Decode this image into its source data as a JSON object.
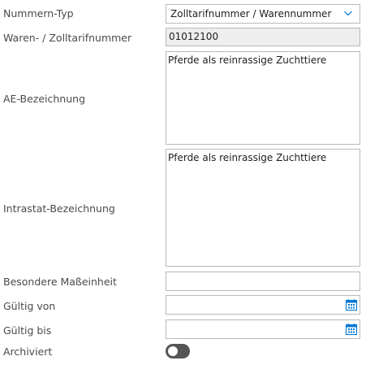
{
  "fields": {
    "nummern_typ": {
      "label": "Nummern-Typ",
      "value": "Zolltarifnummer / Warennummer"
    },
    "waren_zolltarifnummer": {
      "label": "Waren- / Zolltarifnummer",
      "value": "01012100"
    },
    "ae_bezeichnung": {
      "label": "AE-Bezeichnung",
      "value": "Pferde als reinrassige Zuchttiere"
    },
    "intrastat_bezeichnung": {
      "label": "Intrastat-Bezeichnung",
      "value": "Pferde als reinrassige Zuchttiere"
    },
    "besondere_masseinheit": {
      "label": "Besondere Maßeinheit",
      "value": ""
    },
    "gueltig_von": {
      "label": "Gültig von",
      "value": ""
    },
    "gueltig_bis": {
      "label": "Gültig bis",
      "value": ""
    },
    "archiviert": {
      "label": "Archiviert",
      "state": "off"
    }
  },
  "icons": {
    "dropdown": "chevron-down-icon",
    "calendar": "calendar-icon"
  },
  "colors": {
    "accent": "#0078d4",
    "toggle_off": "#555555",
    "readonly_bg": "#eeeeee",
    "border": "#b9b9b9"
  }
}
